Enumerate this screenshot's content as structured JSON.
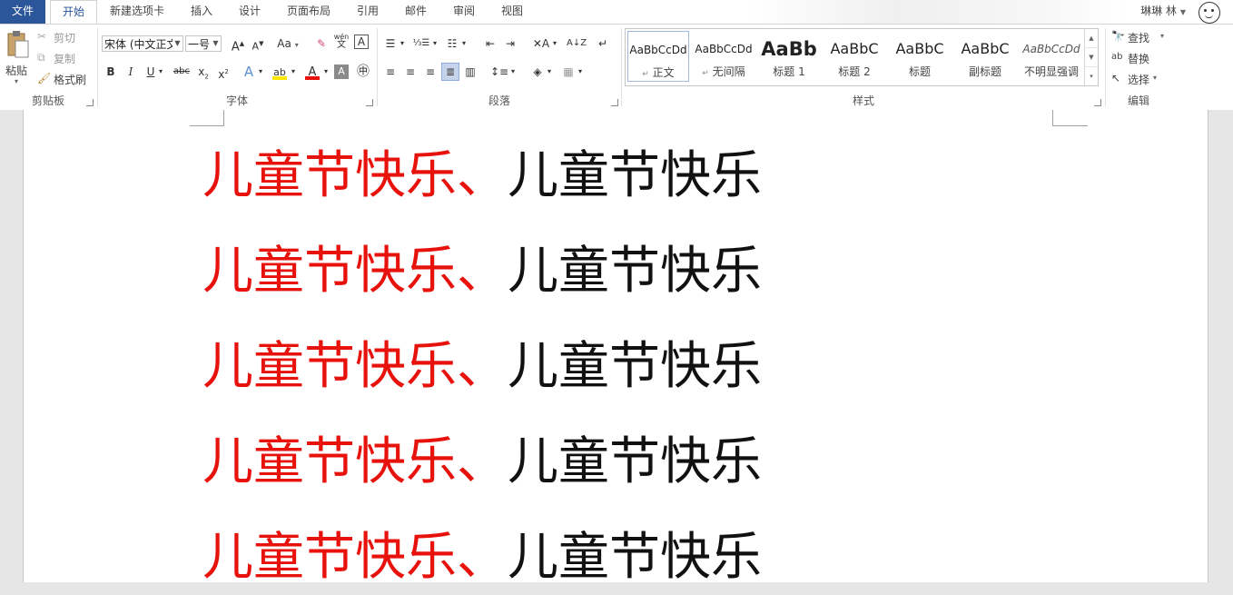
{
  "tabs": [
    {
      "label": "文件"
    },
    {
      "label": "开始"
    },
    {
      "label": "新建选项卡"
    },
    {
      "label": "插入"
    },
    {
      "label": "设计"
    },
    {
      "label": "页面布局"
    },
    {
      "label": "引用"
    },
    {
      "label": "邮件"
    },
    {
      "label": "审阅"
    },
    {
      "label": "视图"
    }
  ],
  "user": {
    "name": "琳琳 林"
  },
  "clipboard": {
    "paste": "粘贴",
    "cut": "剪切",
    "copy": "复制",
    "format_painter": "格式刷",
    "label": "剪贴板"
  },
  "font": {
    "name": "宋体 (中文正文",
    "size": "一号",
    "label": "字体",
    "case_label": "Aa",
    "phonetic_top": "wén",
    "phonetic_bottom": "文"
  },
  "paragraph": {
    "label": "段落"
  },
  "styles": {
    "label": "样式",
    "items": [
      {
        "sample": "AaBbCcDd",
        "name": "正文"
      },
      {
        "sample": "AaBbCcDd",
        "name": "无间隔"
      },
      {
        "sample": "AaBb",
        "name": "标题 1"
      },
      {
        "sample": "AaBbC",
        "name": "标题 2"
      },
      {
        "sample": "AaBbC",
        "name": "标题"
      },
      {
        "sample": "AaBbC",
        "name": "副标题"
      },
      {
        "sample": "AaBbCcDd",
        "name": "不明显强调"
      }
    ]
  },
  "editing": {
    "find": "查找",
    "replace": "替换",
    "select": "选择",
    "label": "编辑"
  },
  "document": {
    "lines": [
      {
        "red": "儿童节快乐、",
        "black": "儿童节快乐"
      },
      {
        "red": "儿童节快乐、",
        "black": "儿童节快乐"
      },
      {
        "red": "儿童节快乐、",
        "black": "儿童节快乐"
      },
      {
        "red": "儿童节快乐、",
        "black": "儿童节快乐"
      },
      {
        "red": "儿童节快乐、",
        "black": "儿童节快乐"
      }
    ]
  },
  "colors": {
    "accent": "#2b579a",
    "red_text": "#e8120c",
    "highlight": "#ffe600",
    "font_color": "#e8120c"
  }
}
